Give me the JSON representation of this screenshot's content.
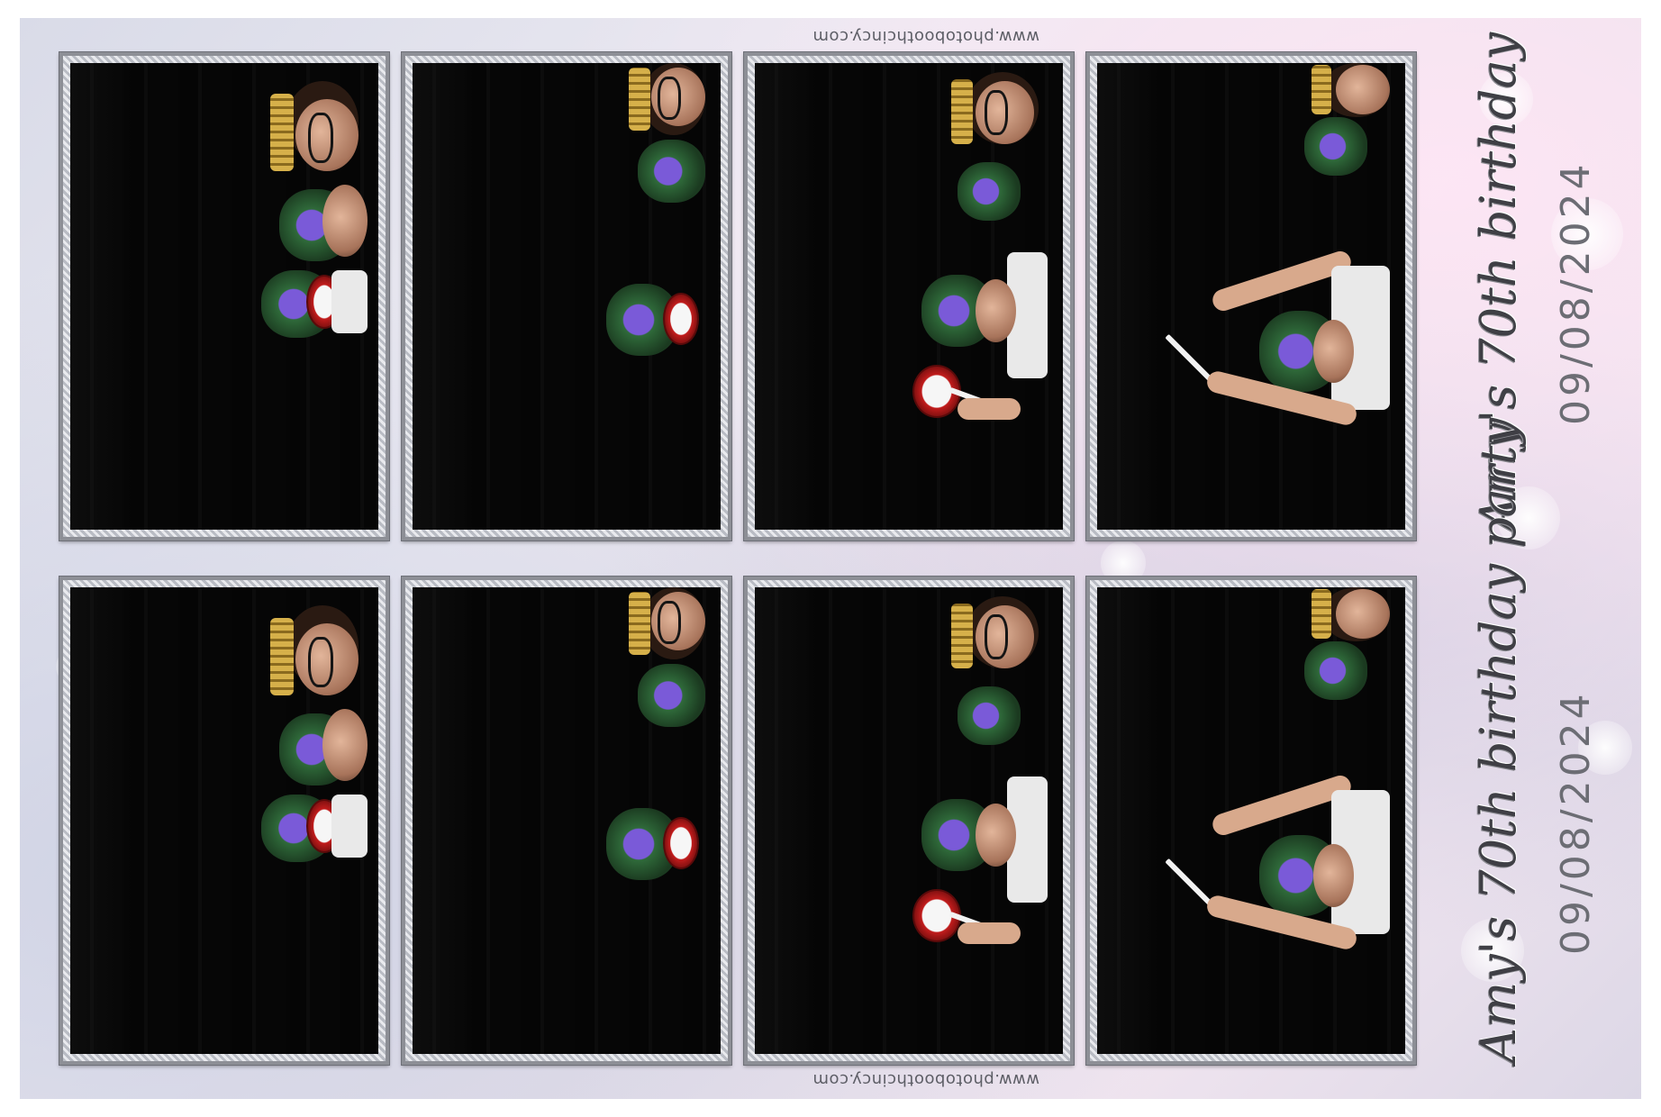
{
  "strip": {
    "title": "Amy's 70th birthday party",
    "date": "09/08/2024",
    "watermark": "www.photoboothcincy.com"
  },
  "photos": [
    {
      "row": "top",
      "index": 1,
      "scene": "three-guests-crown-mask-teeth-prop"
    },
    {
      "row": "top",
      "index": 2,
      "scene": "guests-peeking-from-edge"
    },
    {
      "row": "top",
      "index": 3,
      "scene": "guests-with-lips-prop"
    },
    {
      "row": "top",
      "index": 4,
      "scene": "guest-with-wand"
    },
    {
      "row": "bottom",
      "index": 1,
      "scene": "three-guests-crown-mask-teeth-prop"
    },
    {
      "row": "bottom",
      "index": 2,
      "scene": "guests-peeking-from-edge"
    },
    {
      "row": "bottom",
      "index": 3,
      "scene": "guests-with-lips-prop"
    },
    {
      "row": "bottom",
      "index": 4,
      "scene": "guest-with-wand"
    }
  ],
  "colors": {
    "frame": "#8d8f96",
    "backdrop": "#050505",
    "title_text": "#3f3f45",
    "date_text": "#6c6d74"
  }
}
